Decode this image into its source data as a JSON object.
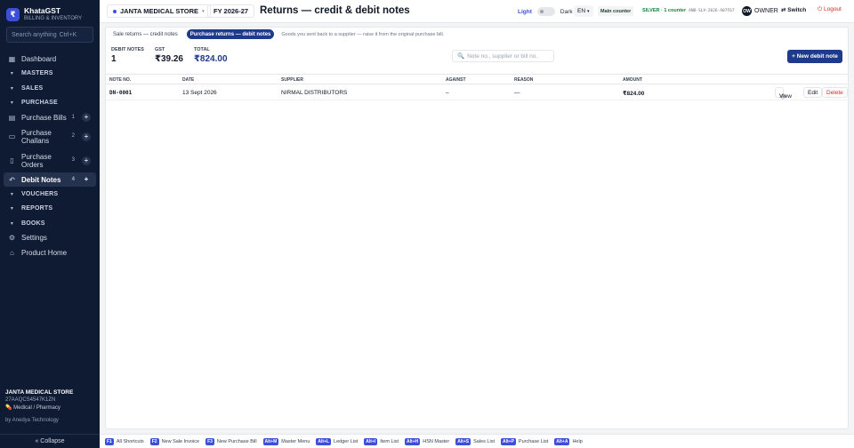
{
  "app": {
    "logo_glyph": "₹",
    "name": "KhataGST",
    "subtitle": "BILLING & INVENTORY"
  },
  "sidebar": {
    "search_placeholder": "Search anything",
    "search_shortcut": "Ctrl+K",
    "items": [
      {
        "label": "Dashboard",
        "icon": "grid-icon"
      },
      {
        "label": "MASTERS",
        "icon": "chevron-down-icon"
      },
      {
        "label": "SALES",
        "icon": "chevron-down-icon"
      },
      {
        "label": "PURCHASE",
        "icon": "chevron-down-icon"
      },
      {
        "label": "Purchase Bills",
        "count": "1",
        "plus": "+",
        "icon": "receipt-icon"
      },
      {
        "label": "Purchase Challans",
        "count": "2",
        "plus": "+",
        "icon": "truck-icon"
      },
      {
        "label": "Purchase Orders",
        "count": "3",
        "plus": "+",
        "icon": "clipboard-icon"
      },
      {
        "label": "Debit Notes",
        "count": "4",
        "plus": "+",
        "icon": "return-icon"
      },
      {
        "label": "VOUCHERS",
        "icon": "chevron-down-icon"
      },
      {
        "label": "REPORTS",
        "icon": "chevron-down-icon"
      },
      {
        "label": "BOOKS",
        "icon": "chevron-down-icon"
      },
      {
        "label": "Settings",
        "icon": "gear-icon"
      },
      {
        "label": "Product Home",
        "icon": "home-icon"
      }
    ],
    "footer": {
      "store_name": "JANTA MEDICAL STORE",
      "gstin": "27AAQCS4547K1ZN",
      "business_type": "Medical / Pharmacy",
      "by": "by Anedya Technology"
    },
    "collapse_label": "« Collapse"
  },
  "topbar": {
    "store": "JANTA MEDICAL STORE",
    "fy": "FY 2026-27",
    "title": "Returns — credit & debit notes",
    "theme_light": "Light",
    "theme_dark": "Dark",
    "lang": "EN",
    "counter": "Main counter",
    "license": "SILVER · 1 counter",
    "license_key": "ANB-SLV-2026-A07F67",
    "avatar_initials": "OW",
    "role": "OWNER",
    "switch_label": "Switch",
    "logout_label": "Logout"
  },
  "main": {
    "tabs": [
      {
        "label": "Sale returns — credit notes",
        "active": false
      },
      {
        "label": "Purchase returns — debit notes",
        "active": true
      }
    ],
    "tab_hint": "Goods you sent back to a supplier — raise it from the original purchase bill.",
    "stats": [
      {
        "label": "DEBIT NOTES",
        "value": "1"
      },
      {
        "label": "GST",
        "value": "₹39.26"
      },
      {
        "label": "TOTAL",
        "value": "₹824.00"
      }
    ],
    "search_placeholder": "Note no., supplier or bill no.",
    "new_button": "+ New debit note",
    "columns": [
      "NOTE NO.",
      "DATE",
      "SUPPLIER",
      "AGAINST",
      "REASON",
      "AMOUNT"
    ],
    "rows": [
      {
        "note_no": "DN-0001",
        "date": "13 Sept 2026",
        "supplier": "NIRMAL DISTRIBUTORS",
        "against": "–",
        "reason": "—",
        "amount": "₹824.00",
        "view": "View",
        "edit": "Edit",
        "delete": "Delete"
      }
    ]
  },
  "shortcuts": [
    {
      "key": "F1",
      "label": "All Shortcuts"
    },
    {
      "key": "F2",
      "label": "New Sale Invoice"
    },
    {
      "key": "F3",
      "label": "New Purchase Bill"
    },
    {
      "key": "Alt+M",
      "label": "Master Menu"
    },
    {
      "key": "Alt+L",
      "label": "Ledger List"
    },
    {
      "key": "Alt+I",
      "label": "Item List"
    },
    {
      "key": "Alt+H",
      "label": "HSN Master"
    },
    {
      "key": "Alt+S",
      "label": "Sales List"
    },
    {
      "key": "Alt+P",
      "label": "Purchase List"
    },
    {
      "key": "Alt+A",
      "label": "Help"
    }
  ],
  "colors": {
    "sidebar_bg": "#0f1b33",
    "accent": "#1e3a8a",
    "brand": "#3b4fd8",
    "danger": "#dc2626",
    "license": "#15803d"
  }
}
